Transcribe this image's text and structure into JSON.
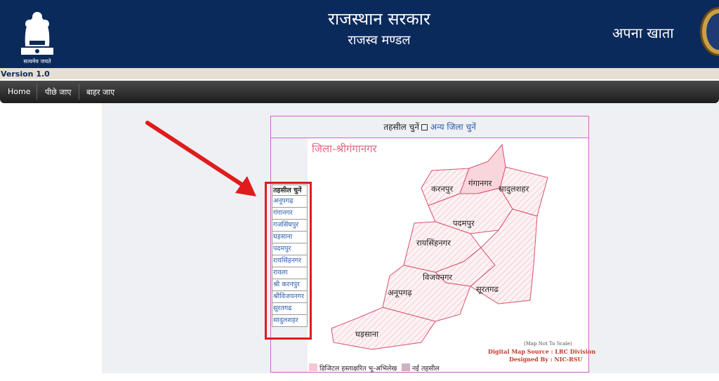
{
  "header": {
    "emblem_caption": "सत्यमेव जयते",
    "title": "राजस्थान सरकार",
    "subtitle": "राजस्व मण्डल",
    "right_title": "अपना खाता"
  },
  "version": "Version 1.0",
  "nav": {
    "home": "Home",
    "back": "पीछे जाए",
    "exit": "बाहर जाए"
  },
  "panel": {
    "select_tehsil": "तहसील चुनें",
    "other_district": "अन्य जिला चुनें"
  },
  "tehsil_list": {
    "heading": "तहसील चुनें",
    "items": [
      "अनूपगढ़",
      "गंगानगर",
      "गजसिंघपुर",
      "घड़साना",
      "पदमपुर",
      "रायसिंहनगर",
      "रावला",
      "श्री करनपुर",
      "श्रीविजयनगर",
      "सूरतगढ",
      "सादुलशहर"
    ]
  },
  "map": {
    "title": "जिला-श्रीगंगानगर",
    "labels": {
      "karanpur": "करनपुर",
      "ganganagar": "गंगानगर",
      "sadulshahar": "सादुलशहर",
      "padampur": "पदमपुर",
      "raisinghnagar": "रायसिंहनगर",
      "vijaynagar": "विजयनगर",
      "anupgarh": "अनूपगढ़",
      "suratgarh": "सूरतगढ",
      "gharsana": "घड़साना"
    },
    "note": "(Map Not To Scale)",
    "source": "Digital Map Source : LRC Division",
    "designed": "Designed By : NIC-RSU",
    "legend_signed": "डिजिटल हस्ताक्षरित भू-अभिलेख",
    "legend_new": "नई तहसील"
  },
  "colors": {
    "header_bg": "#0b2a5c",
    "map_fill": "#fbe3e7",
    "map_stroke": "#d9506d",
    "highlight_red": "#e01b1b",
    "link": "#2a5caa"
  }
}
